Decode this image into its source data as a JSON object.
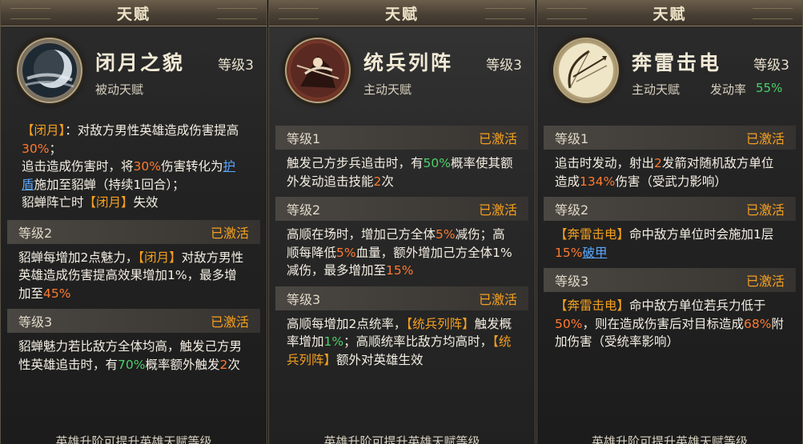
{
  "panels": [
    {
      "title": "天赋",
      "name": "闭月之貌",
      "level": "等级3",
      "type": "被动天赋",
      "icon": "moon-icon",
      "desc_parts": [
        {
          "t": "【闭月】",
          "c": "y"
        },
        {
          "t": "：对敌方男性英雄造成伤害提高",
          "c": ""
        },
        {
          "t": "30%",
          "c": "o"
        },
        {
          "t": "；",
          "c": ""
        },
        {
          "t": "\n追击造成伤害时，将",
          "c": ""
        },
        {
          "t": "30%",
          "c": "o"
        },
        {
          "t": "伤害转化为",
          "c": ""
        },
        {
          "t": "护盾",
          "c": "b"
        },
        {
          "t": "施加至貂蝉（持续1回合）；",
          "c": ""
        },
        {
          "t": "\n貂蝉阵亡时",
          "c": ""
        },
        {
          "t": "【闭月】",
          "c": "y"
        },
        {
          "t": "失效",
          "c": ""
        }
      ],
      "levels": [
        {
          "label": "等级2",
          "status": "已激活",
          "parts": [
            {
              "t": "貂蝉每增加2点魅力，",
              "c": ""
            },
            {
              "t": "【闭月】",
              "c": "y"
            },
            {
              "t": "对敌方男性英雄造成伤害提高效果增加1%，最多增加至",
              "c": ""
            },
            {
              "t": "45%",
              "c": "o"
            }
          ]
        },
        {
          "label": "等级3",
          "status": "已激活",
          "parts": [
            {
              "t": "貂蝉魅力若比敌方全体均高，触发己方男性英雄追击时，有",
              "c": ""
            },
            {
              "t": "70%",
              "c": "g"
            },
            {
              "t": "概率额外触发",
              "c": ""
            },
            {
              "t": "2",
              "c": "o"
            },
            {
              "t": "次",
              "c": ""
            }
          ]
        }
      ],
      "footer": "英雄升阶可提升英雄天赋等级"
    },
    {
      "title": "天赋",
      "name": "统兵列阵",
      "level": "等级3",
      "type": "主动天赋",
      "icon": "warrior-icon",
      "levels": [
        {
          "label": "等级1",
          "status": "已激活",
          "parts": [
            {
              "t": "触发己方步兵追击时，有",
              "c": ""
            },
            {
              "t": "50%",
              "c": "g"
            },
            {
              "t": "概率使其额外发动追击技能",
              "c": ""
            },
            {
              "t": "2",
              "c": "o"
            },
            {
              "t": "次",
              "c": ""
            }
          ]
        },
        {
          "label": "等级2",
          "status": "已激活",
          "parts": [
            {
              "t": "高顺在场时，增加己方全体",
              "c": ""
            },
            {
              "t": "5%",
              "c": "o"
            },
            {
              "t": "减伤；高顺每降低",
              "c": ""
            },
            {
              "t": "5%",
              "c": "o"
            },
            {
              "t": "血量，额外增加己方全体1%减伤，最多增加至",
              "c": ""
            },
            {
              "t": "15%",
              "c": "o"
            }
          ]
        },
        {
          "label": "等级3",
          "status": "已激活",
          "parts": [
            {
              "t": "高顺每增加2点统率，",
              "c": ""
            },
            {
              "t": "【统兵列阵】",
              "c": "y"
            },
            {
              "t": "触发概率增加",
              "c": ""
            },
            {
              "t": "1%",
              "c": "g"
            },
            {
              "t": "；高顺统率比敌方均高时，",
              "c": ""
            },
            {
              "t": "【统兵列阵】",
              "c": "y"
            },
            {
              "t": "额外对英雄生效",
              "c": ""
            }
          ]
        }
      ],
      "footer": "英雄升阶可提升英雄天赋等级"
    },
    {
      "title": "天赋",
      "name": "奔雷击电",
      "level": "等级3",
      "type": "主动天赋",
      "rate_label": "发动率",
      "rate_value": "55%",
      "icon": "bow-icon",
      "levels": [
        {
          "label": "等级1",
          "status": "已激活",
          "parts": [
            {
              "t": "追击时发动，射出",
              "c": ""
            },
            {
              "t": "2",
              "c": "o"
            },
            {
              "t": "发箭对随机敌方单位造成",
              "c": ""
            },
            {
              "t": "134%",
              "c": "o"
            },
            {
              "t": "伤害（受武力影响）",
              "c": ""
            }
          ]
        },
        {
          "label": "等级2",
          "status": "已激活",
          "parts": [
            {
              "t": "【奔雷击电】",
              "c": "y"
            },
            {
              "t": "命中敌方单位时会施加1层",
              "c": ""
            },
            {
              "t": "15%",
              "c": "o"
            },
            {
              "t": "破甲",
              "c": "b"
            }
          ]
        },
        {
          "label": "等级3",
          "status": "已激活",
          "parts": [
            {
              "t": "【奔雷击电】",
              "c": "y"
            },
            {
              "t": "命中敌方单位若兵力低于",
              "c": ""
            },
            {
              "t": "50%",
              "c": "o"
            },
            {
              "t": "，则在造成伤害后对目标造成",
              "c": ""
            },
            {
              "t": "68%",
              "c": "o"
            },
            {
              "t": "附加伤害（受统率影响）",
              "c": ""
            }
          ]
        }
      ],
      "footer": "英雄升阶可提升英雄天赋等级"
    }
  ]
}
